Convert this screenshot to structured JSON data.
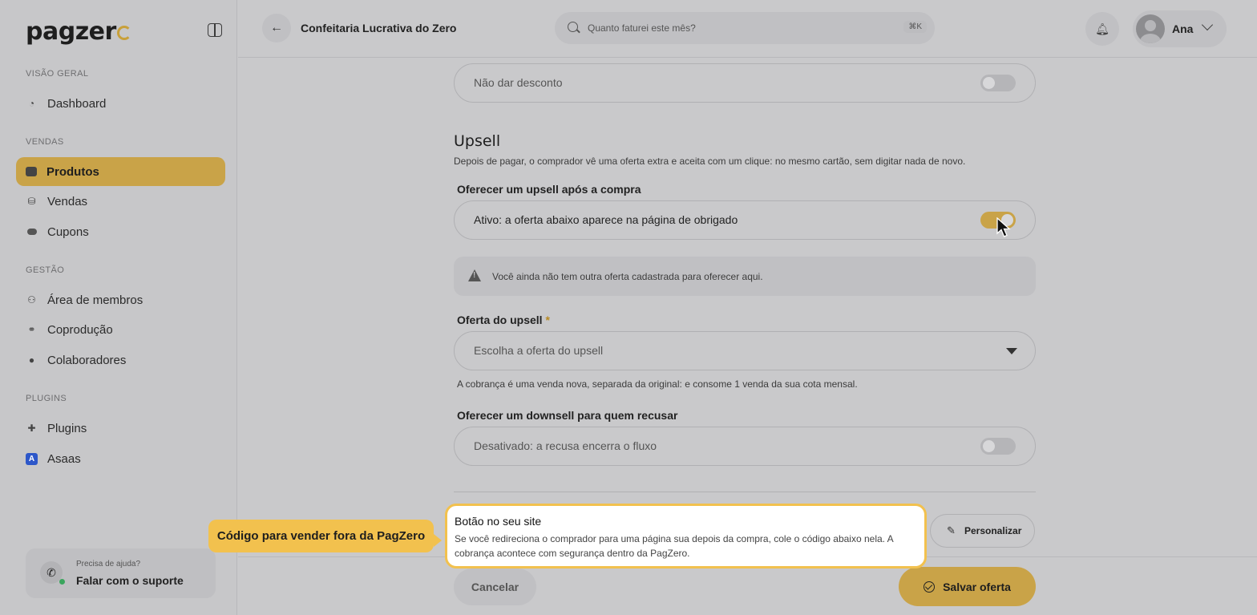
{
  "app": {
    "logo_text": "pagzer"
  },
  "sidebar": {
    "sections": [
      {
        "label": "VISÃO GERAL"
      },
      {
        "label": "VENDAS"
      },
      {
        "label": "GESTÃO"
      },
      {
        "label": "PLUGINS"
      }
    ],
    "items": [
      {
        "label": "Dashboard",
        "icon": "dashboard-icon"
      },
      {
        "label": "Produtos",
        "icon": "products-icon",
        "active": true
      },
      {
        "label": "Vendas",
        "icon": "sales-icon"
      },
      {
        "label": "Cupons",
        "icon": "coupon-icon"
      },
      {
        "label": "Área de membros",
        "icon": "members-icon"
      },
      {
        "label": "Coprodução",
        "icon": "handshake-icon"
      },
      {
        "label": "Colaboradores",
        "icon": "person-icon"
      },
      {
        "label": "Plugins",
        "icon": "puzzle-icon"
      },
      {
        "label": "Asaas",
        "icon": "asaas-icon"
      }
    ],
    "help": {
      "small": "Precisa de ajuda?",
      "big": "Falar com o suporte"
    }
  },
  "header": {
    "title": "Confeitaria Lucrativa do Zero",
    "search_placeholder": "Quanto faturei este mês?",
    "shortcut": "⌘K",
    "user_name": "Ana"
  },
  "form": {
    "discount_field": "Não dar desconto",
    "upsell_heading": "Upsell",
    "upsell_desc": "Depois de pagar, o comprador vê uma oferta extra e aceita com um clique: no mesmo cartão, sem digitar nada de novo.",
    "upsell_toggle_label": "Oferecer um upsell após a compra",
    "upsell_toggle_text": "Ativo: a oferta abaixo aparece na página de obrigado",
    "warning": "Você ainda não tem outra oferta cadastrada para oferecer aqui.",
    "offer_label": "Oferta do upsell",
    "required_mark": "*",
    "offer_placeholder": "Escolha a oferta do upsell",
    "offer_hint": "A cobrança é uma venda nova, separada da original: e consome 1 venda da sua cota mensal.",
    "downsell_label": "Oferecer um downsell para quem recusar",
    "downsell_text": "Desativado: a recusa encerra o fluxo",
    "personalize": "Personalizar",
    "cancel": "Cancelar",
    "save": "Salvar oferta"
  },
  "tour": {
    "tip": "Código para vender fora da PagZero",
    "title": "Botão no seu site",
    "body": "Se você redireciona o comprador para uma página sua depois da compra, cole o código abaixo nela. A cobrança acontece com segurança dentro da PagZero."
  },
  "colors": {
    "accent": "#c9a348",
    "tour": "#f2c14e"
  }
}
